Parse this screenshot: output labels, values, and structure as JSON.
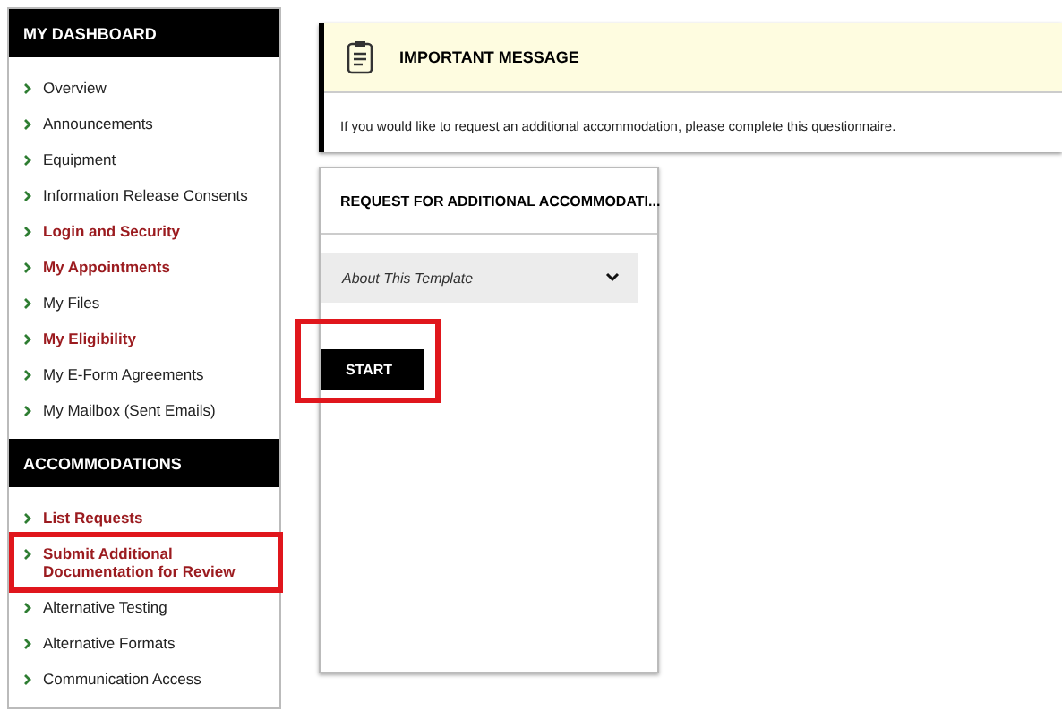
{
  "sidebar": [
    {
      "heading": "MY DASHBOARD",
      "items": [
        {
          "label": "Overview",
          "strong": false,
          "highlighted": false
        },
        {
          "label": "Announcements",
          "strong": false,
          "highlighted": false
        },
        {
          "label": "Equipment",
          "strong": false,
          "highlighted": false
        },
        {
          "label": "Information Release Consents",
          "strong": false,
          "highlighted": false
        },
        {
          "label": "Login and Security",
          "strong": true,
          "highlighted": false
        },
        {
          "label": "My Appointments",
          "strong": true,
          "highlighted": false
        },
        {
          "label": "My Files",
          "strong": false,
          "highlighted": false
        },
        {
          "label": "My Eligibility",
          "strong": true,
          "highlighted": false
        },
        {
          "label": "My E-Form Agreements",
          "strong": false,
          "highlighted": false
        },
        {
          "label": "My Mailbox (Sent Emails)",
          "strong": false,
          "highlighted": false
        }
      ]
    },
    {
      "heading": "ACCOMMODATIONS",
      "items": [
        {
          "label": "List Requests",
          "strong": true,
          "highlighted": false
        },
        {
          "label": "Submit Additional Documentation for Review",
          "strong": true,
          "highlighted": true
        },
        {
          "label": "Alternative Testing",
          "strong": false,
          "highlighted": false
        },
        {
          "label": "Alternative Formats",
          "strong": false,
          "highlighted": false
        },
        {
          "label": "Communication Access",
          "strong": false,
          "highlighted": false
        }
      ]
    }
  ],
  "message": {
    "title": "IMPORTANT MESSAGE",
    "body": "If you would like to request an additional accommodation, please complete this questionnaire."
  },
  "card": {
    "title": "REQUEST FOR ADDITIONAL ACCOMMODATI...",
    "accordion": {
      "label": "About This Template",
      "expanded": false
    },
    "button": {
      "label": "START",
      "highlighted": true
    }
  }
}
